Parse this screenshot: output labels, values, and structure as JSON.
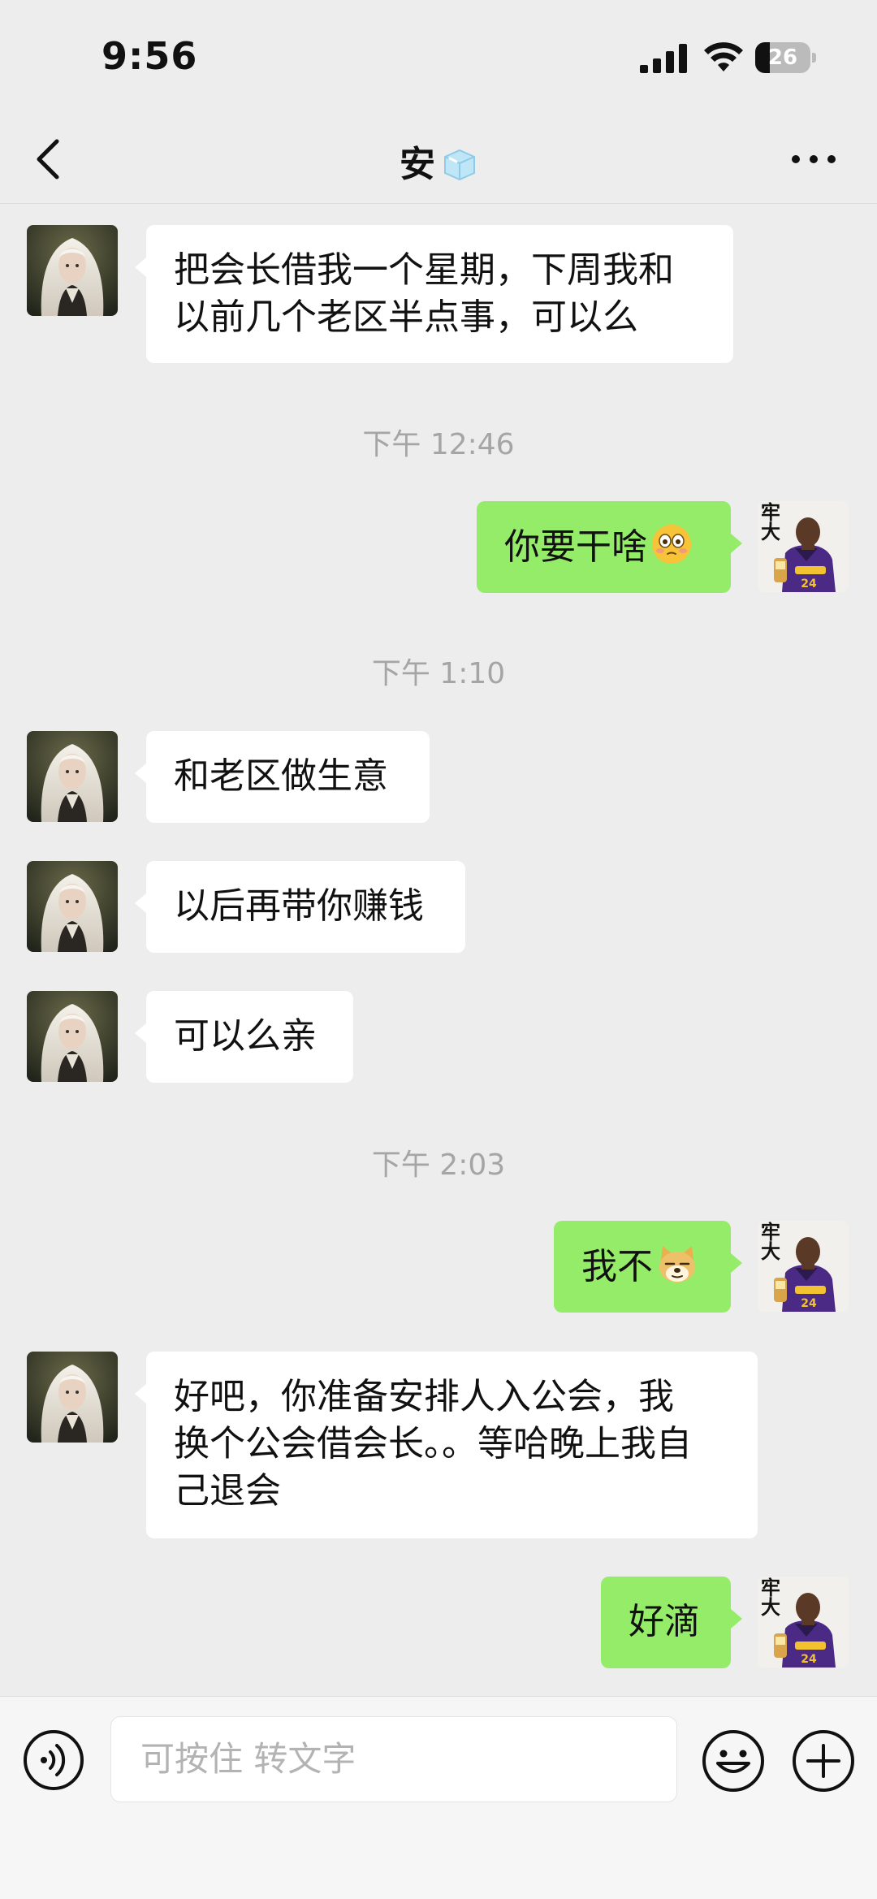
{
  "status_bar": {
    "time": "9:56",
    "battery": "26",
    "battery_level": 0.26
  },
  "header": {
    "title": "安",
    "back_icon": "chevron-left-icon",
    "more_icon": "more-icon"
  },
  "messages": [
    {
      "side": "in",
      "text_lines": [
        "把会长借我一个星期，下周我和",
        "以前几个老区半点事，可以么"
      ]
    },
    {
      "time": "下午 12:46"
    },
    {
      "side": "out",
      "text": "你要干啥",
      "emoji": "flushed-face-emoji"
    },
    {
      "time": "下午 1:10"
    },
    {
      "side": "in",
      "text": "和老区做生意"
    },
    {
      "side": "in",
      "text": "以后再带你赚钱"
    },
    {
      "side": "in",
      "text": "可以么亲"
    },
    {
      "time": "下午 2:03"
    },
    {
      "side": "out",
      "text": "我不",
      "emoji": "doge-emoji"
    },
    {
      "side": "in",
      "text_lines": [
        "好吧，你准备安排人入公会，我",
        "换个公会借会长。。等哈晚上我自",
        "己退会"
      ]
    },
    {
      "side": "out",
      "text": "好滴"
    }
  ],
  "input": {
    "placeholder": "可按住 转文字"
  },
  "icons": {
    "voice": "voice-input-icon",
    "emoji": "emoji-icon",
    "plus": "plus-icon"
  },
  "colors": {
    "background": "#ededed",
    "outgoing_bubble": "#95ec69",
    "incoming_bubble": "#ffffff",
    "timestamp": "#a5a5a5"
  },
  "avatar_caption": "牢大"
}
